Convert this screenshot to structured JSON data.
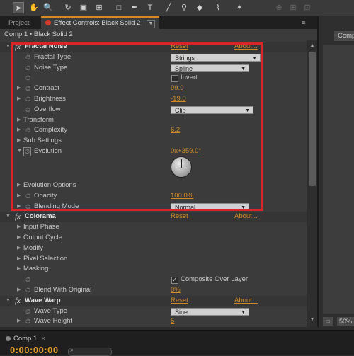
{
  "toolbar": {
    "icons": [
      "select-tool-icon",
      "hand-tool-icon",
      "zoom-tool-icon",
      "rotate-tool-icon",
      "camera-tool-icon",
      "pan-behind-tool-icon",
      "rectangle-mask-tool-icon",
      "pen-tool-icon",
      "text-tool-icon",
      "brush-tool-icon",
      "clone-stamp-tool-icon",
      "eraser-tool-icon",
      "roto-brush-tool-icon",
      "puppet-pin-tool-icon"
    ]
  },
  "tabs": {
    "project": "Project",
    "effect_controls": "Effect Controls: Black Solid 2",
    "menu_glyph": "≡"
  },
  "breadcrumb": "Comp 1 • Black Solid 2",
  "effects": [
    {
      "name": "Fractal Noise",
      "reset": "Reset",
      "about": "About..."
    },
    {
      "name": "Colorama",
      "reset": "Reset",
      "about": "About..."
    },
    {
      "name": "Wave Warp",
      "reset": "Reset",
      "about": "About..."
    }
  ],
  "fractal": {
    "fractal_type": {
      "label": "Fractal Type",
      "value": "Strings"
    },
    "noise_type": {
      "label": "Noise Type",
      "value": "Spline"
    },
    "invert": {
      "label": "Invert",
      "checked": false
    },
    "contrast": {
      "label": "Contrast",
      "value": "99.0"
    },
    "brightness": {
      "label": "Brightness",
      "value": "-19.0"
    },
    "overflow": {
      "label": "Overflow",
      "value": "Clip"
    },
    "transform": {
      "label": "Transform"
    },
    "complexity": {
      "label": "Complexity",
      "value": "6.2"
    },
    "sub_settings": {
      "label": "Sub Settings"
    },
    "evolution": {
      "label": "Evolution",
      "value": "0x+359.0°"
    },
    "evolution_options": {
      "label": "Evolution Options"
    },
    "opacity": {
      "label": "Opacity",
      "value": "100.0%"
    },
    "blending_mode": {
      "label": "Blending Mode",
      "value": "Normal"
    }
  },
  "colorama": {
    "input_phase": "Input Phase",
    "output_cycle": "Output Cycle",
    "modify": "Modify",
    "pixel_selection": "Pixel Selection",
    "masking": "Masking",
    "composite_over_layer": {
      "label": "Composite Over Layer",
      "checked": true
    },
    "blend_with_original": {
      "label": "Blend With Original",
      "value": "0%"
    }
  },
  "wave_warp": {
    "wave_type": {
      "label": "Wave Type",
      "value": "Sine"
    },
    "wave_height": {
      "label": "Wave Height",
      "value": "5"
    }
  },
  "right_panel": {
    "tab_label": "Comp",
    "zoom": "50%"
  },
  "timeline": {
    "tab": "Comp 1",
    "timecode": "0:00:00:00"
  },
  "colors": {
    "accent": "#e59f27",
    "highlight_box": "#d9252a",
    "panel": "#3b3b3b"
  }
}
